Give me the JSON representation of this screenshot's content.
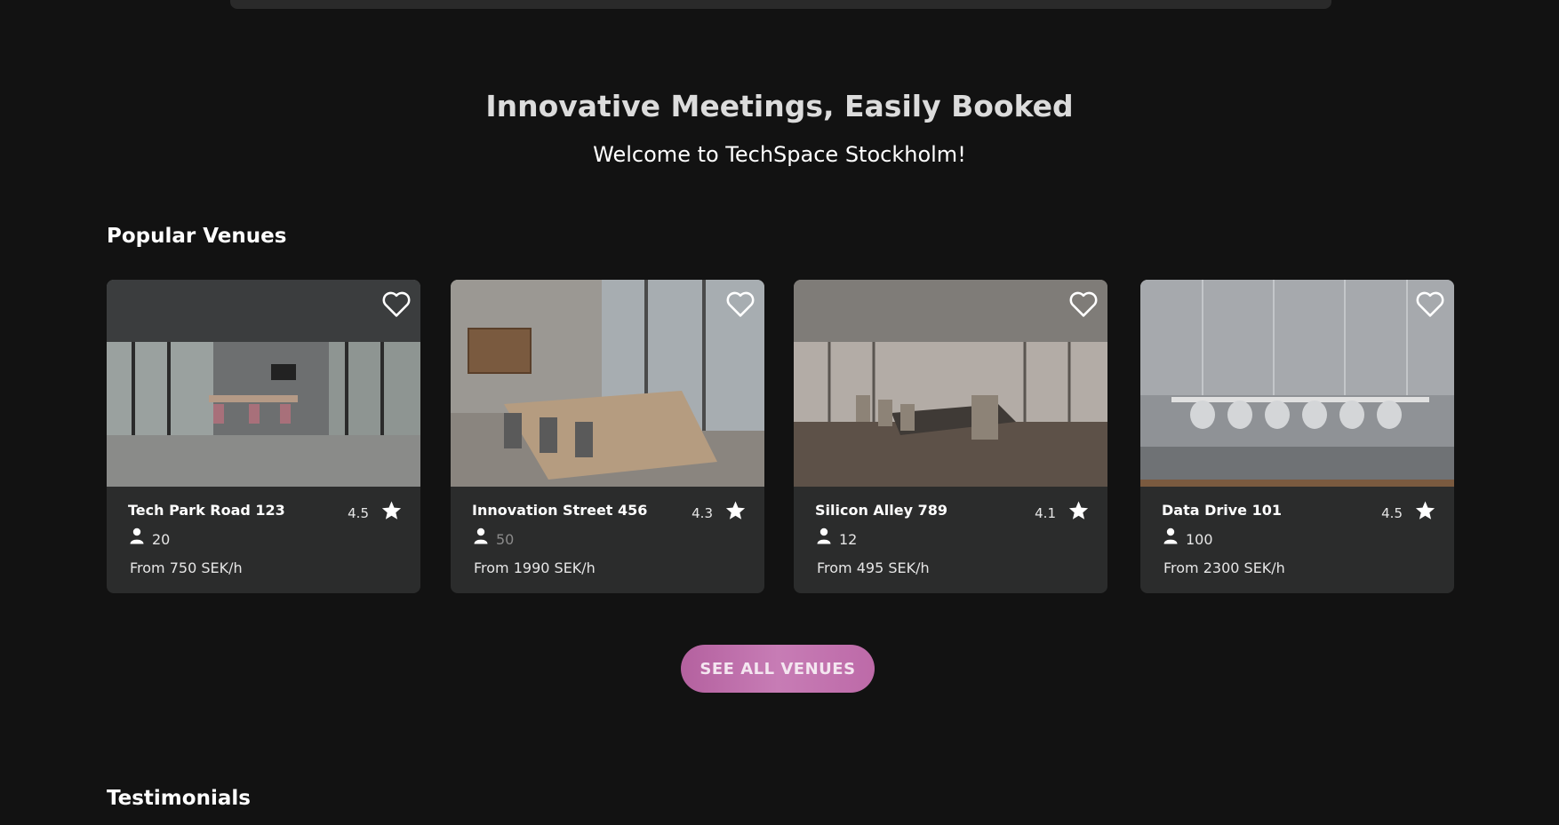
{
  "hero": {
    "title": "Innovative Meetings, Easily Booked",
    "subtitle": "Welcome to TechSpace Stockholm!"
  },
  "popular": {
    "title": "Popular Venues",
    "venues": [
      {
        "name": "Tech Park Road 123",
        "rating": "4.5",
        "capacity": "20",
        "price": "From 750 SEK/h"
      },
      {
        "name": "Innovation Street 456",
        "rating": "4.3",
        "capacity": "50",
        "price": "From 1990 SEK/h"
      },
      {
        "name": "Silicon Alley 789",
        "rating": "4.1",
        "capacity": "12",
        "price": "From 495 SEK/h"
      },
      {
        "name": "Data Drive 101",
        "rating": "4.5",
        "capacity": "100",
        "price": "From 2300 SEK/h"
      }
    ]
  },
  "actions": {
    "see_all_label": "SEE ALL VENUES"
  },
  "testimonials": {
    "title": "Testimonials"
  },
  "icons": {
    "favorite": "heart-outline-icon",
    "rating": "star-icon",
    "capacity": "person-icon"
  },
  "colors": {
    "background": "#121212",
    "card": "#2b2c2c",
    "accent": "#c77cb5"
  }
}
